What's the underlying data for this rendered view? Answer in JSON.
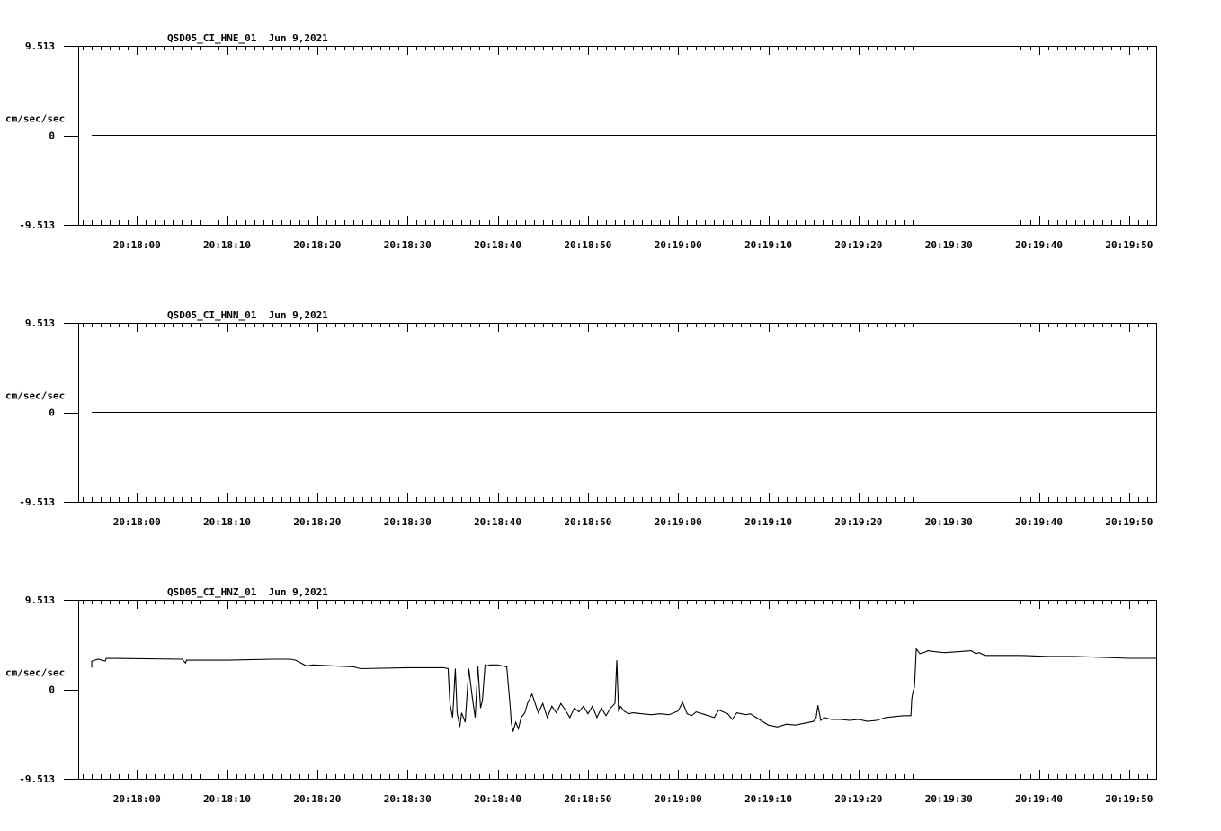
{
  "chart_data": [
    {
      "type": "line",
      "title": "QSD05_CI_HNE_01  Jun 9,2021",
      "ylabel": "cm/sec/sec",
      "ylim": [
        -9.513,
        9.513
      ],
      "y_ticks": [
        {
          "value": 9.513,
          "label": "9.513"
        },
        {
          "value": 0,
          "label": "0"
        },
        {
          "value": -9.513,
          "label": "-9.513"
        }
      ],
      "x_domain_seconds": [
        -6.5,
        113.0
      ],
      "x_ticks": [
        "20:18:00",
        "20:18:10",
        "20:18:20",
        "20:18:30",
        "20:18:40",
        "20:18:50",
        "20:19:00",
        "20:19:10",
        "20:19:20",
        "20:19:30",
        "20:19:40",
        "20:19:50"
      ],
      "x_tick_seconds": [
        0,
        10,
        20,
        30,
        40,
        50,
        60,
        70,
        80,
        90,
        100,
        110
      ],
      "grid": false,
      "series": [
        {
          "x": [
            -5.0,
            113.0
          ],
          "y": [
            0,
            0
          ]
        }
      ]
    },
    {
      "type": "line",
      "title": "QSD05_CI_HNN_01  Jun 9,2021",
      "ylabel": "cm/sec/sec",
      "ylim": [
        -9.513,
        9.513
      ],
      "y_ticks": [
        {
          "value": 9.513,
          "label": "9.513"
        },
        {
          "value": 0,
          "label": "0"
        },
        {
          "value": -9.513,
          "label": "-9.513"
        }
      ],
      "x_domain_seconds": [
        -6.5,
        113.0
      ],
      "x_ticks": [
        "20:18:00",
        "20:18:10",
        "20:18:20",
        "20:18:30",
        "20:18:40",
        "20:18:50",
        "20:19:00",
        "20:19:10",
        "20:19:20",
        "20:19:30",
        "20:19:40",
        "20:19:50"
      ],
      "x_tick_seconds": [
        0,
        10,
        20,
        30,
        40,
        50,
        60,
        70,
        80,
        90,
        100,
        110
      ],
      "grid": false,
      "series": [
        {
          "x": [
            -5.0,
            113.0
          ],
          "y": [
            0,
            0
          ]
        }
      ]
    },
    {
      "type": "line",
      "title": "QSD05_CI_HNZ_01  Jun 9,2021",
      "ylabel": "cm/sec/sec",
      "ylim": [
        -9.513,
        9.513
      ],
      "y_ticks": [
        {
          "value": 9.513,
          "label": "9.513"
        },
        {
          "value": 0,
          "label": "0"
        },
        {
          "value": -9.513,
          "label": "-9.513"
        }
      ],
      "x_domain_seconds": [
        -6.5,
        113.0
      ],
      "x_ticks": [
        "20:18:00",
        "20:18:10",
        "20:18:20",
        "20:18:30",
        "20:18:40",
        "20:18:50",
        "20:19:00",
        "20:19:10",
        "20:19:20",
        "20:19:30",
        "20:19:40",
        "20:19:50"
      ],
      "x_tick_seconds": [
        0,
        10,
        20,
        30,
        40,
        50,
        60,
        70,
        80,
        90,
        100,
        110
      ],
      "grid": false,
      "series": [
        {
          "x": [
            -5.0,
            -5.0,
            -4.3,
            -3.5,
            -3.4,
            5.0,
            5.4,
            5.5,
            10.0,
            15.0,
            17.0,
            17.6,
            18.8,
            19.5,
            24.0,
            24.8,
            30.0,
            34.0,
            34.5,
            34.7,
            35.0,
            35.3,
            35.5,
            35.8,
            36.0,
            36.4,
            36.8,
            37.2,
            37.5,
            37.8,
            38.1,
            38.3,
            38.6,
            38.8,
            39.1,
            39.5,
            40.0,
            41.0,
            41.4,
            41.5,
            41.7,
            42.0,
            42.3,
            42.6,
            43.0,
            43.3,
            43.8,
            44.5,
            45.0,
            45.5,
            46.0,
            46.5,
            47.0,
            47.5,
            48.0,
            48.5,
            49.0,
            49.5,
            50.0,
            50.5,
            51.0,
            51.5,
            52.0,
            52.5,
            53.0,
            53.2,
            53.4,
            53.6,
            54.0,
            54.5,
            55.0,
            56.0,
            57.0,
            58.0,
            59.0,
            60.0,
            60.5,
            61.0,
            61.5,
            62.0,
            63.0,
            64.0,
            64.5,
            65.0,
            65.5,
            66.0,
            66.5,
            67.0,
            67.5,
            68.0,
            69.0,
            70.0,
            71.0,
            72.0,
            73.0,
            74.0,
            75.0,
            75.3,
            75.5,
            75.8,
            76.2,
            77.0,
            78.0,
            79.0,
            80.0,
            81.0,
            82.0,
            83.0,
            84.0,
            85.0,
            85.8,
            85.9,
            86.0,
            86.2,
            86.4,
            86.8,
            87.2,
            87.7,
            88.5,
            89.5,
            91.0,
            92.5,
            93.0,
            93.4,
            94.0,
            98.0,
            101.0,
            104.0,
            107.0,
            110.0,
            113.0
          ],
          "y": [
            2.3,
            3.0,
            3.2,
            3.0,
            3.3,
            3.2,
            2.8,
            3.1,
            3.1,
            3.2,
            3.2,
            3.1,
            2.5,
            2.6,
            2.4,
            2.2,
            2.3,
            2.3,
            2.2,
            -1.5,
            -3.0,
            2.2,
            -2.5,
            -4.0,
            -2.5,
            -3.5,
            2.2,
            -1.0,
            -3.0,
            2.5,
            -2.0,
            -1.2,
            2.6,
            2.5,
            2.6,
            2.6,
            2.6,
            2.4,
            -2.0,
            -3.5,
            -4.5,
            -3.5,
            -4.2,
            -3.0,
            -2.5,
            -1.5,
            -0.5,
            -2.5,
            -1.5,
            -3.0,
            -1.8,
            -2.5,
            -1.5,
            -2.2,
            -3.0,
            -2.0,
            -2.4,
            -1.8,
            -2.6,
            -1.8,
            -3.0,
            -2.0,
            -2.8,
            -2.0,
            -1.5,
            3.1,
            -2.4,
            -1.8,
            -2.3,
            -2.6,
            -2.5,
            -2.6,
            -2.7,
            -2.6,
            -2.7,
            -2.3,
            -1.4,
            -2.6,
            -2.8,
            -2.4,
            -2.7,
            -3.0,
            -2.2,
            -2.4,
            -2.6,
            -3.2,
            -2.5,
            -2.6,
            -2.7,
            -2.6,
            -3.2,
            -3.8,
            -4.0,
            -3.7,
            -3.8,
            -3.6,
            -3.4,
            -3.0,
            -1.7,
            -3.3,
            -3.0,
            -3.2,
            -3.2,
            -3.3,
            -3.2,
            -3.4,
            -3.3,
            -3.0,
            -2.9,
            -2.8,
            -2.8,
            -1.0,
            -0.4,
            0.3,
            4.3,
            3.8,
            3.9,
            4.1,
            4.0,
            3.9,
            4.0,
            4.1,
            3.8,
            3.9,
            3.6,
            3.6,
            3.5,
            3.5,
            3.4,
            3.3,
            3.3
          ]
        }
      ]
    }
  ]
}
